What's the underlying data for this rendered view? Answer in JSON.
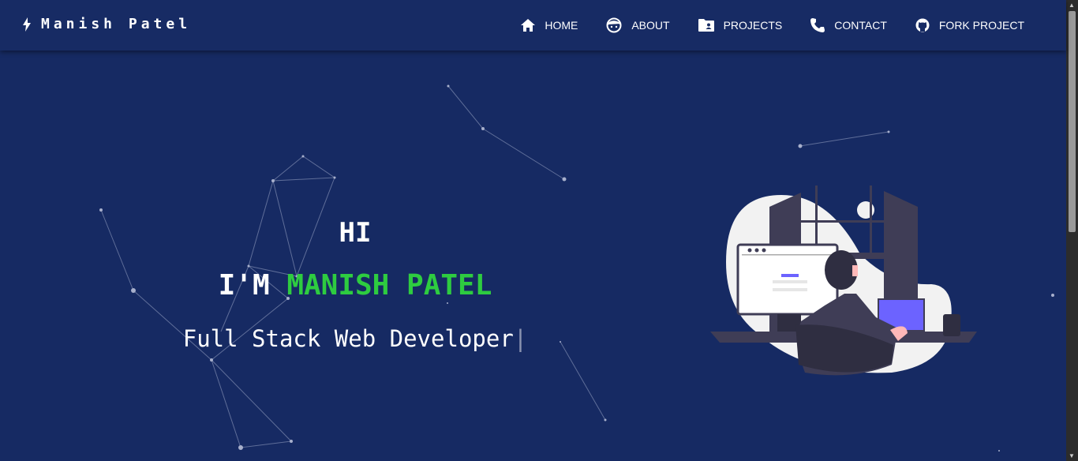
{
  "brand": {
    "name": "Manish Patel",
    "icon": "bolt-icon"
  },
  "nav": [
    {
      "label": "HOME",
      "icon": "home-icon"
    },
    {
      "label": "ABOUT",
      "icon": "face-icon"
    },
    {
      "label": "PROJECTS",
      "icon": "folder-shared-icon"
    },
    {
      "label": "CONTACT",
      "icon": "phone-icon"
    },
    {
      "label": "FORK PROJECT",
      "icon": "github-icon"
    }
  ],
  "hero": {
    "greeting": "HI",
    "intro": "I'M",
    "name": "MANISH PATEL",
    "role": "Full Stack Web Developer",
    "cursor": "|"
  },
  "colors": {
    "background": "#162a63",
    "accent": "#2ecc40"
  }
}
